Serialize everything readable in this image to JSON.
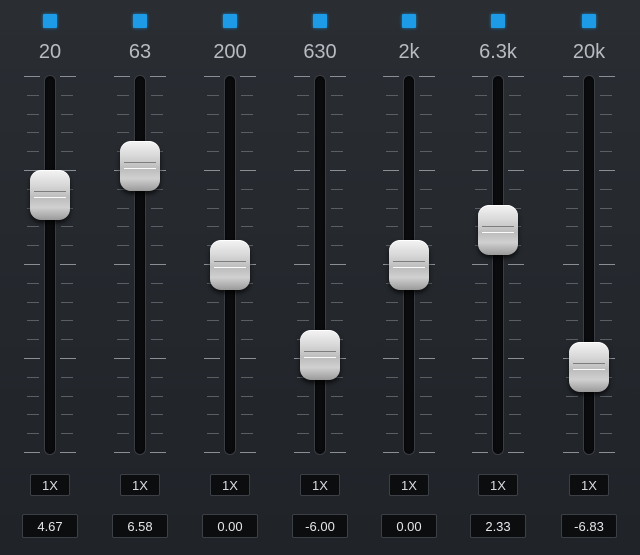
{
  "equalizer": {
    "bands": [
      {
        "freq": "20",
        "multiplier": "1X",
        "value_label": "4.67",
        "gain": 4.67
      },
      {
        "freq": "63",
        "multiplier": "1X",
        "value_label": "6.58",
        "gain": 6.58
      },
      {
        "freq": "200",
        "multiplier": "1X",
        "value_label": "0.00",
        "gain": 0.0
      },
      {
        "freq": "630",
        "multiplier": "1X",
        "value_label": "-6.00",
        "gain": -6.0
      },
      {
        "freq": "2k",
        "multiplier": "1X",
        "value_label": "0.00",
        "gain": 0.0
      },
      {
        "freq": "6.3k",
        "multiplier": "1X",
        "value_label": "2.33",
        "gain": 2.33
      },
      {
        "freq": "20k",
        "multiplier": "1X",
        "value_label": "-6.83",
        "gain": -6.83
      }
    ],
    "gain_range": [
      -12,
      12
    ],
    "colors": {
      "led": "#1d9be6",
      "background": "#24282d",
      "text": "#b8bcc2"
    }
  }
}
